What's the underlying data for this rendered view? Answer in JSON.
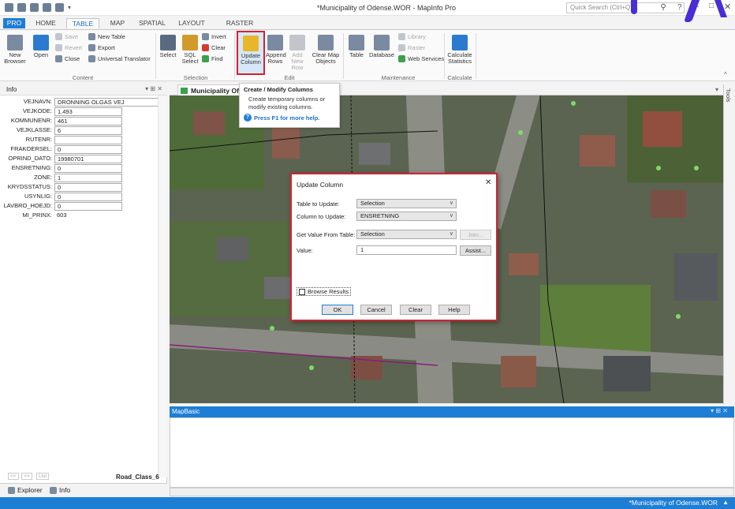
{
  "window": {
    "title": "*Municipality of Odense.WOR - MapInfo Pro",
    "search_placeholder": "Quick Search (Ctrl+Q)",
    "help": "?",
    "minimize": "–",
    "maximize": "□",
    "close": "✕"
  },
  "ribbon_tabs": [
    "PRO",
    "HOME",
    "TABLE",
    "MAP",
    "SPATIAL",
    "LAYOUT",
    "RASTER"
  ],
  "ribbon": {
    "new_browser": "New Browser",
    "open": "Open",
    "save": "Save",
    "revert": "Revert",
    "close": "Close",
    "new_table": "New Table",
    "export": "Export",
    "universal_translator": "Universal Translator",
    "content_group": "Content",
    "select": "Select",
    "sql_select": "SQL Select",
    "invert": "Invert",
    "clear": "Clear",
    "find": "Find",
    "selection_group": "Selection",
    "update_column": "Update Column",
    "append_rows": "Append Rows",
    "add_new_row": "Add New Row",
    "clear_map_objects": "Clear Map Objects",
    "edit_group": "Edit",
    "table": "Table",
    "database": "Database",
    "library": "Library",
    "raster": "Raster",
    "web_services": "Web Services",
    "maintenance_group": "Maintenance",
    "calculate_statistics": "Calculate Statistics",
    "calculate_group": "Calculate"
  },
  "tooltip": {
    "title": "Create / Modify Columns",
    "description": "Create temporary columns or modify existing columns.",
    "help": "Press F1 for more help."
  },
  "info_panel": {
    "title": "Info",
    "fields": [
      {
        "label": "VEJNAVN:",
        "value": "DRONNING OLGAS VEJ"
      },
      {
        "label": "VEJKODE:",
        "value": "1.493"
      },
      {
        "label": "KOMMUNENR:",
        "value": "461"
      },
      {
        "label": "VEJKLASSE:",
        "value": "6"
      },
      {
        "label": "RUTENR:",
        "value": ""
      },
      {
        "label": "FRAKOERSEL:",
        "value": "0"
      },
      {
        "label": "OPRIND_DATO:",
        "value": "19980701"
      },
      {
        "label": "ENSRETNING:",
        "value": "0"
      },
      {
        "label": "ZONE:",
        "value": "1"
      },
      {
        "label": "KRYDSSTATUS:",
        "value": "0"
      },
      {
        "label": "USYNLIG:",
        "value": "0"
      },
      {
        "label": "LAVBRO_HOEJD:",
        "value": "0"
      },
      {
        "label": "MI_PRINX:",
        "value": "603"
      }
    ],
    "nav": [
      "<<",
      ">>",
      "List"
    ],
    "layer": "Road_Class_6"
  },
  "bottom_tabs": [
    "Explorer",
    "Info"
  ],
  "map": {
    "title": "Municipality Of O",
    "tools": "Tools"
  },
  "dialog": {
    "title": "Update Column",
    "table_to_update_label": "Table to Update:",
    "table_to_update_value": "Selection",
    "column_to_update_label": "Column to Update:",
    "column_to_update_value": "ENSRETNING",
    "get_value_label": "Get Value From Table:",
    "get_value_value": "Selection",
    "join_button": "Join...",
    "value_label": "Value:",
    "value_value": "1",
    "assist_button": "Assist...",
    "browse_results": "Browse Results",
    "ok": "OK",
    "cancel": "Cancel",
    "clear": "Clear",
    "help": "Help"
  },
  "mapbasic": {
    "title": "MapBasic"
  },
  "status": {
    "workspace": "*Municipality of Odense.WOR"
  }
}
